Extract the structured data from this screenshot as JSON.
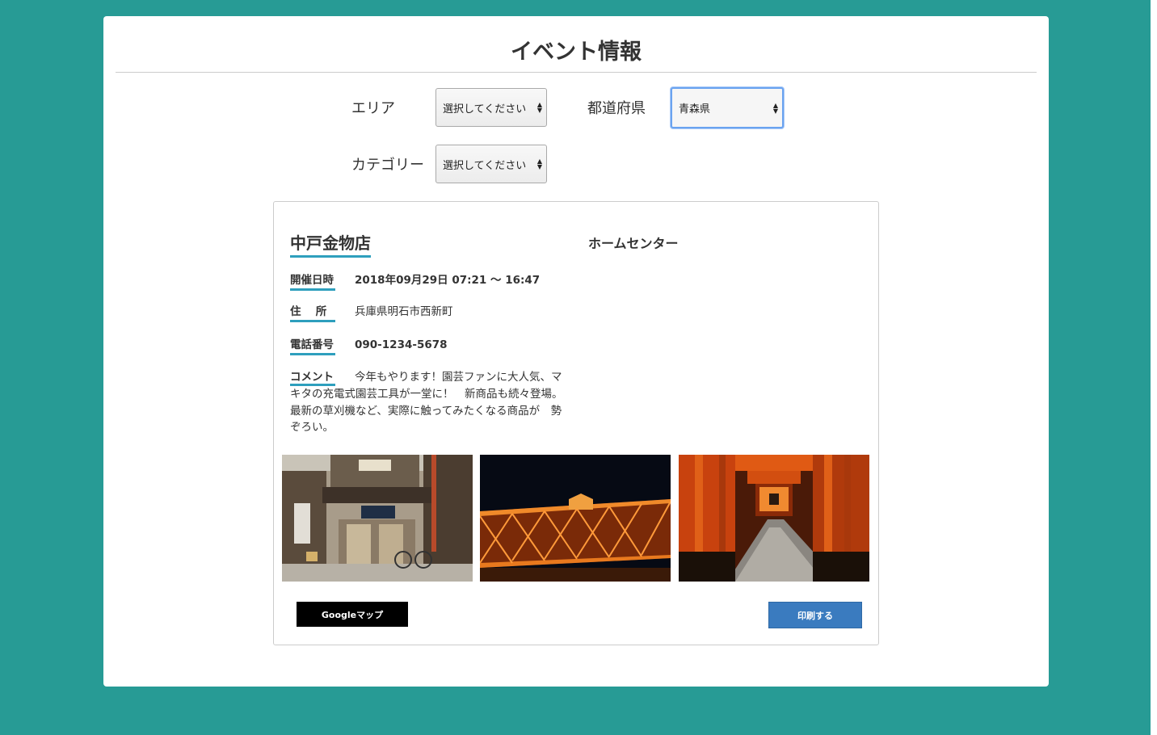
{
  "page": {
    "title": "イベント情報"
  },
  "filters": {
    "area_label": "エリア",
    "area_value": "選択してください",
    "prefecture_label": "都道府県",
    "prefecture_value": "青森県",
    "category_label": "カテゴリー",
    "category_value": "選択してください"
  },
  "event": {
    "shop_name": "中戸金物店",
    "category": "ホームセンター",
    "date_label": "開催日時",
    "date_value": "2018年09月29日 07:21 〜 16:47",
    "address_label": "住　 所",
    "address_value": "兵庫県明石市西新町",
    "phone_label": "電話番号",
    "phone_value": "090-1234-5678",
    "comment_label": "コメント",
    "comment_value": "今年もやります！園芸ファンに大人気、マキタの充電式園芸工具が一堂に！　新商品も続々登場。最新の草刈機など、実際に触ってみたくなる商品が　勢ぞろい。",
    "photos": [
      "storefront-photo",
      "illuminated-bridge-photo",
      "torii-gates-photo"
    ]
  },
  "buttons": {
    "map": "Googleマップ",
    "print": "印刷する"
  },
  "colors": {
    "background": "#279b95",
    "accent_underline": "#2e9fbd",
    "print_button": "#3a7bbf",
    "map_button": "#000000"
  }
}
